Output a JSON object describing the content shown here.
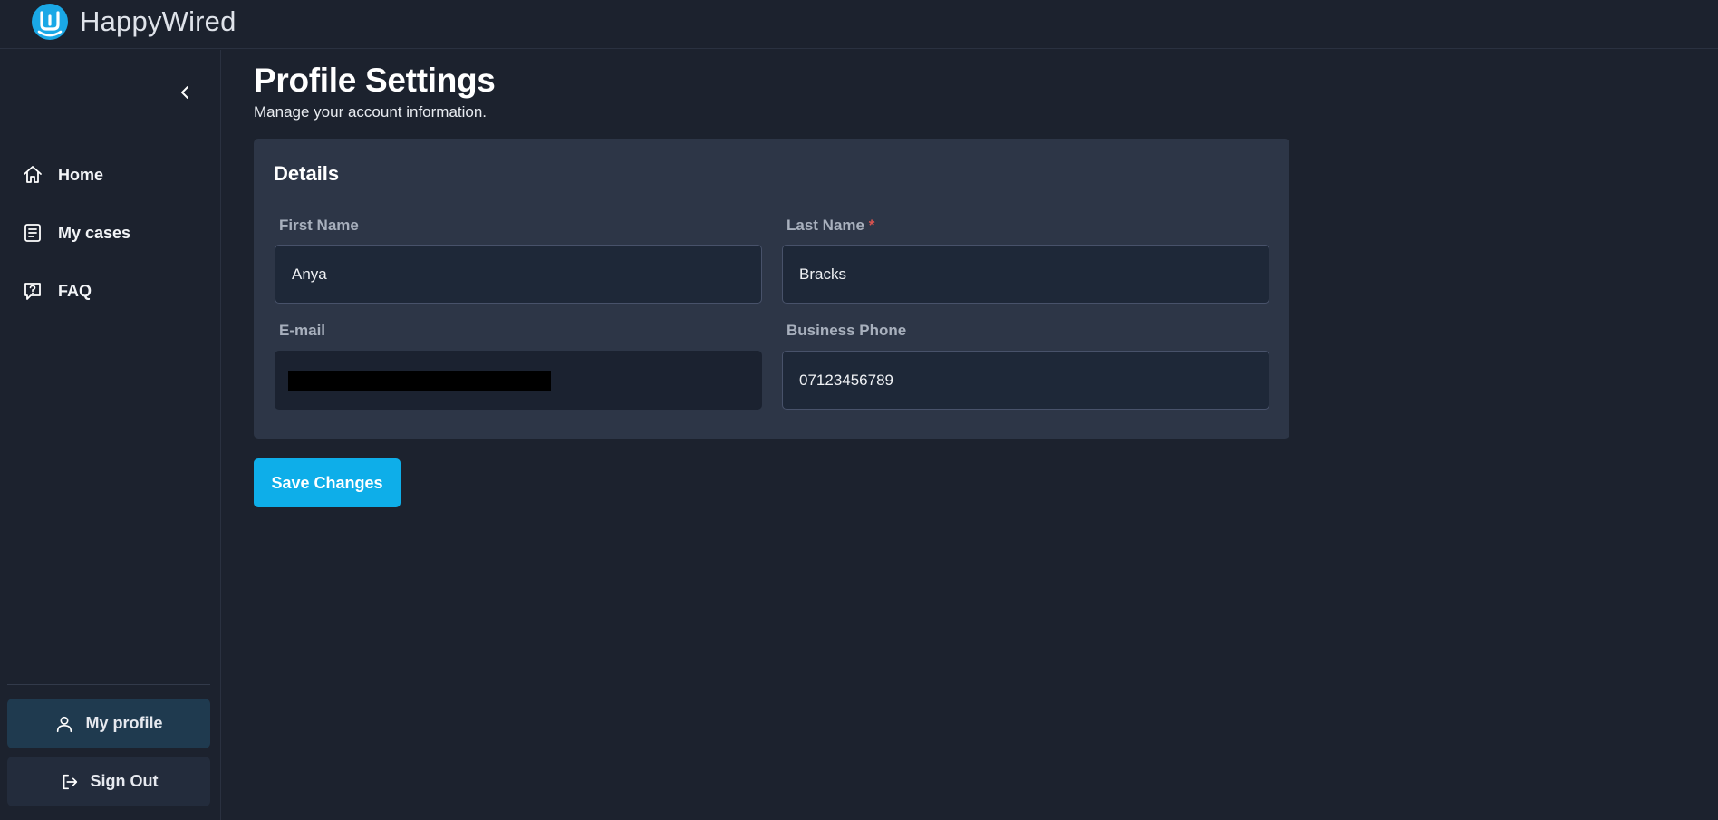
{
  "app": {
    "name": "HappyWired",
    "accent_color": "#0eaee9"
  },
  "sidebar": {
    "collapse_icon": "chevron-left-icon",
    "items": [
      {
        "label": "Home",
        "icon": "home-icon"
      },
      {
        "label": "My cases",
        "icon": "document-icon"
      },
      {
        "label": "FAQ",
        "icon": "question-chat-icon"
      }
    ],
    "profile_button": {
      "label": "My profile",
      "icon": "user-icon"
    },
    "signout_button": {
      "label": "Sign Out",
      "icon": "sign-out-icon"
    }
  },
  "page": {
    "title": "Profile Settings",
    "subtitle": "Manage your account information."
  },
  "details": {
    "title": "Details",
    "first_name": {
      "label": "First Name",
      "value": "Anya"
    },
    "last_name": {
      "label": "Last Name",
      "required_mark": "*",
      "value": "Bracks"
    },
    "email": {
      "label": "E-mail",
      "value": ""
    },
    "business_phone": {
      "label": "Business Phone",
      "value": "07123456789"
    }
  },
  "actions": {
    "save_label": "Save Changes"
  }
}
